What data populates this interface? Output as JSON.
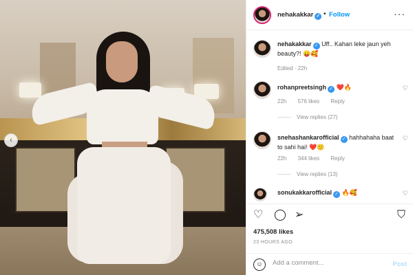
{
  "post": {
    "username": "nehakakkar",
    "follow_label": "Follow",
    "dot": "•",
    "more": "···",
    "caption_user": "nehakakkar",
    "caption_text": "Uff.. Kahan leke jaun yeh beauty?! 😛🥰",
    "caption_meta": "Edited · 22h",
    "carousel_prev": "‹"
  },
  "comments": [
    {
      "user": "rohanpreetsingh",
      "text": "❤️🔥",
      "time": "22h",
      "likes": "576 likes",
      "reply": "Reply",
      "view_replies": "View replies (27)"
    },
    {
      "user": "snehashankarofficial",
      "text": "hahhahaha baat to sahi hai! ❤️🙂",
      "time": "22h",
      "likes": "344 likes",
      "reply": "Reply",
      "view_replies": "View replies (13)"
    },
    {
      "user": "sonukakkarofficial",
      "text": "🔥🥰"
    }
  ],
  "footer": {
    "likes": "475,508 likes",
    "timestamp": "23 HOURS AGO",
    "comment_placeholder": "Add a comment...",
    "post_label": "Post",
    "emoji": "☺"
  },
  "icons": {
    "heart": "♡",
    "comment": "◯",
    "share": "➢",
    "save": "⛉"
  }
}
